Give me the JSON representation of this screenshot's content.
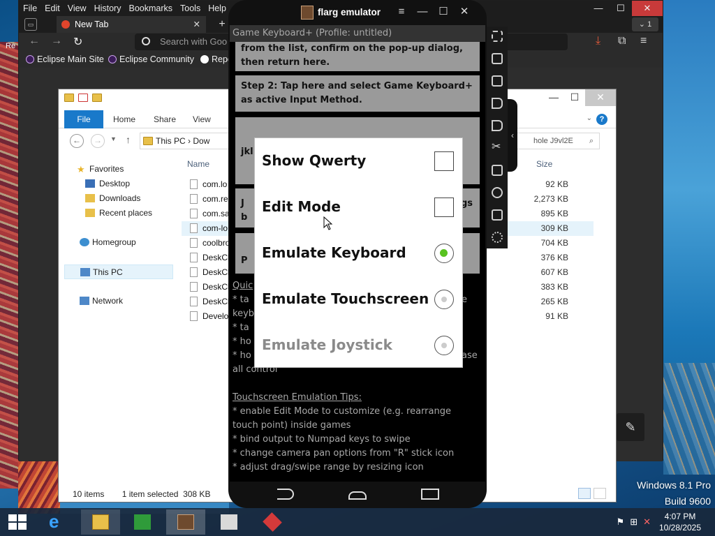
{
  "firefox": {
    "menu": [
      "File",
      "Edit",
      "View",
      "History",
      "Bookmarks",
      "Tools",
      "Help"
    ],
    "tab_title": "New Tab",
    "tab_count": "1",
    "search_placeholder": "Search with Goo",
    "bookmarks": [
      "Eclipse Main Site",
      "Eclipse Community",
      "Repo"
    ]
  },
  "explorer": {
    "ribbon_tabs": [
      "File",
      "Home",
      "Share",
      "View"
    ],
    "path": [
      "This PC",
      "Dow"
    ],
    "search_text": "hole J9vl2E",
    "col_name": "Name",
    "col_size": "Size",
    "nav": [
      "Favorites",
      "Desktop",
      "Downloads",
      "Recent places",
      "Homegroup",
      "This PC",
      "Network"
    ],
    "files": [
      {
        "name": "com.lo",
        "size": "92 KB"
      },
      {
        "name": "com.re",
        "size": "2,273 KB"
      },
      {
        "name": "com.sa",
        "size": "895 KB"
      },
      {
        "name": "com-lo",
        "size": "309 KB"
      },
      {
        "name": "coolbro",
        "size": "704 KB"
      },
      {
        "name": "DeskCl",
        "size": "376 KB"
      },
      {
        "name": "DeskCl",
        "size": "607 KB"
      },
      {
        "name": "DeskCl",
        "size": "383 KB"
      },
      {
        "name": "DeskCl",
        "size": "265 KB"
      },
      {
        "name": "Develop",
        "size": "91 KB"
      }
    ],
    "status_items": "10 items",
    "status_selected": "1 item selected  308 KB"
  },
  "emulator": {
    "title": "flarg emulator",
    "app_header": "Game Keyboard+ (Profile: untitled)",
    "step1_tail": [
      "from the list, confirm on the pop-up dialog,",
      "then return here."
    ],
    "step2": [
      "Step 2: Tap here and select Game Keyboard+",
      "as active Input Method."
    ],
    "partial": {
      "a": "jkl",
      "b": "J",
      "c": "b",
      "d": "gs",
      "e": "P"
    },
    "quick_tips_fragments": [
      "Quic",
      "* ta",
      "keyb",
      "* ta",
      "* ho",
      "* ho",
      "all control",
      "e",
      "ase"
    ],
    "touch_tips_title": "Touchscreen Emulation Tips:",
    "touch_tips": [
      "* enable Edit Mode to customize (e.g. rearrange",
      "touch point) inside games",
      "* bind output to Numpad keys to swipe",
      "* change camera pan options from \"R\" stick icon",
      "* adjust drag/swipe range by resizing icon"
    ],
    "dialog": [
      {
        "label": "Show Qwerty",
        "control": "checkbox",
        "checked": false
      },
      {
        "label": "Edit Mode",
        "control": "checkbox",
        "checked": false
      },
      {
        "label": "Emulate Keyboard",
        "control": "radio",
        "checked": true
      },
      {
        "label": "Emulate Touchscreen",
        "control": "radio",
        "checked": false
      },
      {
        "label": "Emulate Joystick",
        "control": "radio",
        "checked": false
      }
    ]
  },
  "desktop": {
    "os_name": "Windows 8.1 Pro",
    "build": "Build 9600",
    "left_edge_char": "Re"
  },
  "taskbar": {
    "time": "4:07 PM",
    "date": "10/28/2025"
  }
}
